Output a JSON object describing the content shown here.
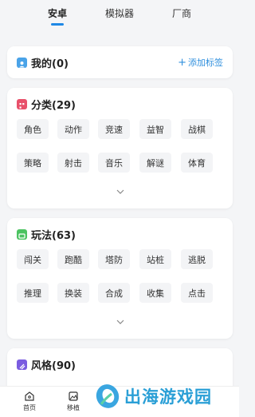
{
  "tabs": [
    {
      "label": "安卓",
      "active": true
    },
    {
      "label": "模拟器",
      "active": false
    },
    {
      "label": "厂商",
      "active": false
    }
  ],
  "accent_color": "#1e88e5",
  "mine": {
    "title": "我的(0)",
    "add_tag_label": "添加标签",
    "icon": "user-square-icon",
    "icon_color": "#4aa3e8"
  },
  "category": {
    "title": "分类(29)",
    "icon": "category-square-icon",
    "icon_color": "#e8506a",
    "tags": [
      "角色",
      "动作",
      "竞速",
      "益智",
      "战棋",
      "策略",
      "射击",
      "音乐",
      "解谜",
      "体育"
    ]
  },
  "gameplay": {
    "title": "玩法(63)",
    "icon": "gameplay-square-icon",
    "icon_color": "#4cc361",
    "tags": [
      "闯关",
      "跑酷",
      "塔防",
      "站桩",
      "逃脱",
      "推理",
      "换装",
      "合成",
      "收集",
      "点击"
    ]
  },
  "style": {
    "title": "风格(90)",
    "icon": "style-square-icon",
    "icon_color": "#7a5ce0"
  },
  "bottom_nav": [
    {
      "label": "首页",
      "icon": "home-icon"
    },
    {
      "label": "移植",
      "icon": "image-icon"
    }
  ],
  "watermark": {
    "text": "出海游戏园",
    "color": "#2a9fd6"
  }
}
